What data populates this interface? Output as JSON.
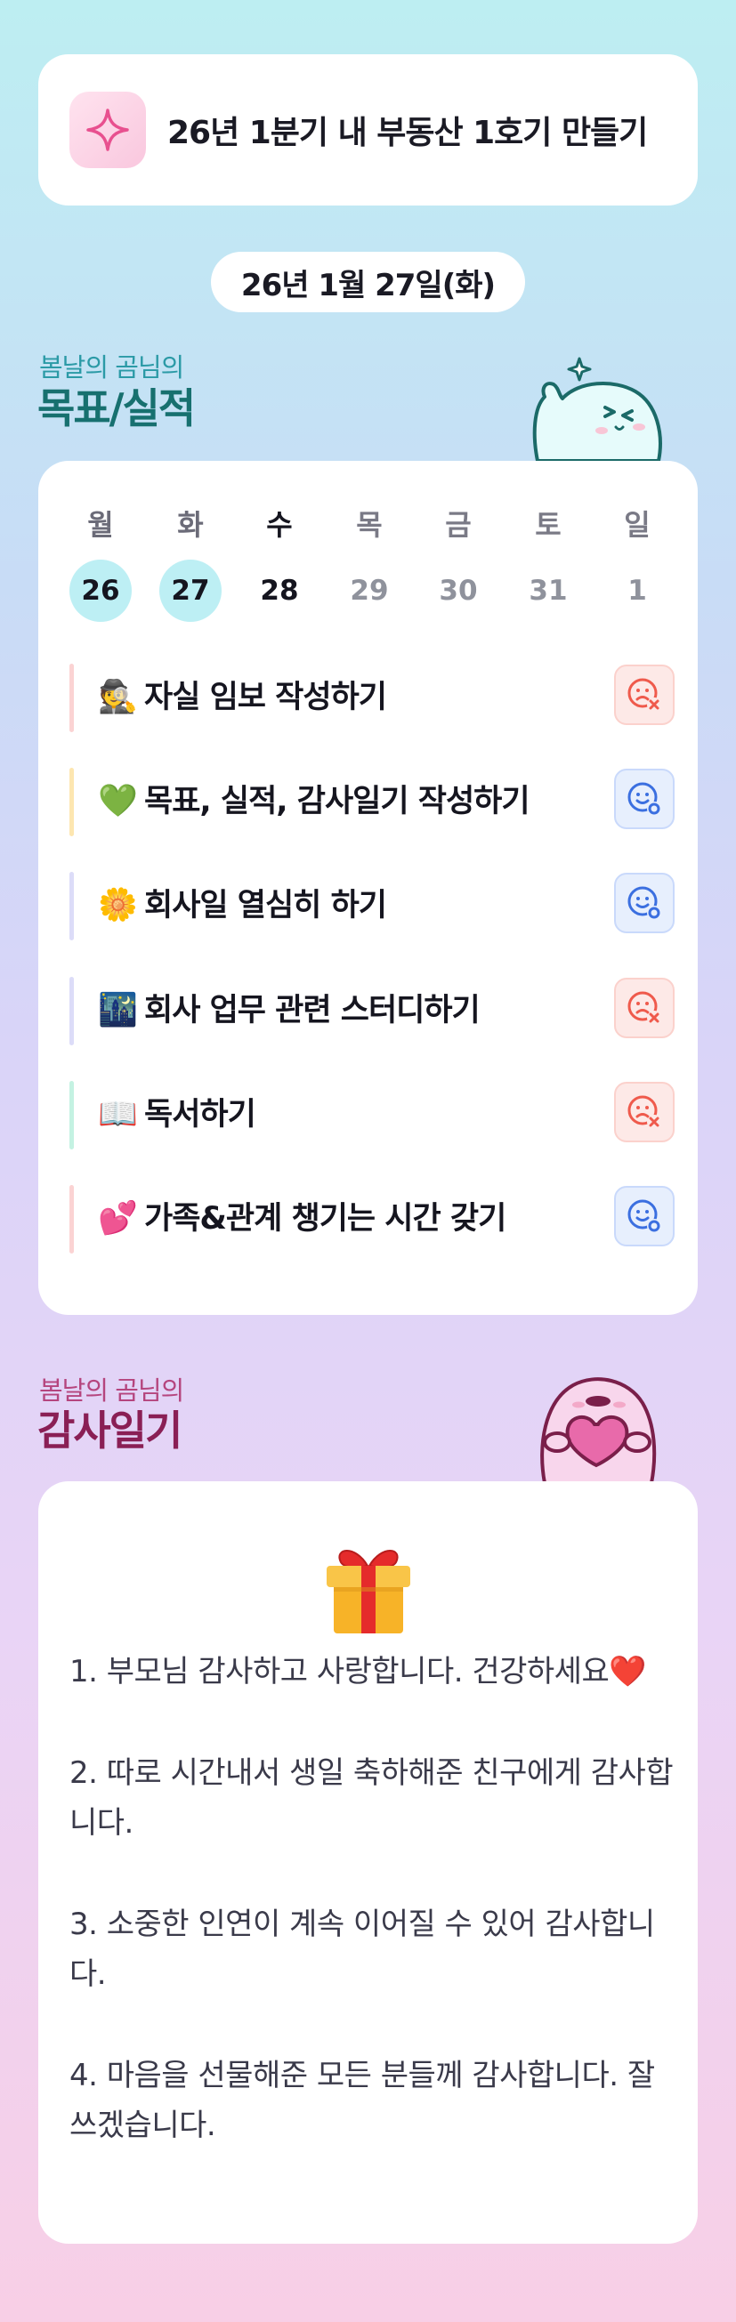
{
  "goal": {
    "icon": "sparkle-icon",
    "text": "26년 1분기 내 부동산 1호기 만들기"
  },
  "date": "26년 1월 27일(화)",
  "performance_section": {
    "subtitle": "봄날의 곰님의",
    "title": "목표/실적"
  },
  "week": {
    "days": [
      {
        "name": "월",
        "num": "26",
        "state": "highlighted"
      },
      {
        "name": "화",
        "num": "27",
        "state": "highlighted"
      },
      {
        "name": "수",
        "num": "28",
        "state": "today"
      },
      {
        "name": "목",
        "num": "29",
        "state": "future"
      },
      {
        "name": "금",
        "num": "30",
        "state": "future"
      },
      {
        "name": "토",
        "num": "31",
        "state": "future"
      },
      {
        "name": "일",
        "num": "1",
        "state": "future"
      }
    ]
  },
  "tasks": [
    {
      "emoji": "🕵️",
      "label": "자실 임보 작성하기",
      "status": "fail",
      "bar_color": "#fbd3d3"
    },
    {
      "emoji": "💚",
      "label": "목표, 실적, 감사일기 작성하기",
      "status": "done",
      "bar_color": "#fde6b0"
    },
    {
      "emoji": "🌼",
      "label": "회사일 열심히 하기",
      "status": "done",
      "bar_color": "#dcdcf8"
    },
    {
      "emoji": "🌃",
      "label": "회사 업무 관련 스터디하기",
      "status": "fail",
      "bar_color": "#dcdcf8"
    },
    {
      "emoji": "📖",
      "label": "독서하기",
      "status": "fail",
      "bar_color": "#c4f2e2"
    },
    {
      "emoji": "💕",
      "label": "가족&관계 챙기는 시간 갖기",
      "status": "done",
      "bar_color": "#fbd3d3"
    }
  ],
  "gratitude_section": {
    "subtitle": "봄날의 곰님의",
    "title": "감사일기"
  },
  "gratitude": {
    "icon": "gift-icon",
    "items": [
      "1. 부모님 감사하고 사랑합니다. 건강하세요❤️",
      "2. 따로 시간내서 생일 축하해준 친구에게 감사합니다.",
      "3. 소중한 인연이 계속 이어질 수 있어 감사합니다.",
      "4. 마음을 선물해준 모든 분들께 감사합니다. 잘 쓰겠습니다."
    ]
  }
}
